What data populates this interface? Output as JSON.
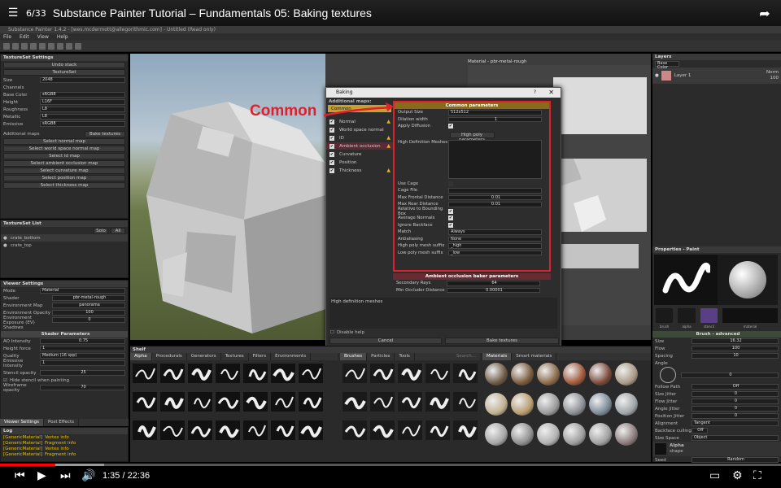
{
  "youtube": {
    "index": "6/33",
    "title": "Substance Painter Tutorial – Fundamentals 05: Baking textures",
    "time": "1:35 / 22:36",
    "progress_fraction": 0.07
  },
  "app": {
    "window_title": "Substance Painter 1.4.2 - [wes.mcdermott@allegorithmic.com] - Untitled (Read only)",
    "menu": [
      "File",
      "Edit",
      "View",
      "Help"
    ]
  },
  "textureset_settings": {
    "title": "TextureSet Settings",
    "undo_stack": "Undo stack",
    "textureset": "TextureSet",
    "size_label": "Size",
    "size_value": "2048",
    "channels_label": "Channels",
    "channels": [
      {
        "name": "Base Color",
        "format": "sRGB8"
      },
      {
        "name": "Height",
        "format": "L16F"
      },
      {
        "name": "Roughness",
        "format": "L8"
      },
      {
        "name": "Metallic",
        "format": "L8"
      },
      {
        "name": "Emissive",
        "format": "sRGB8"
      }
    ],
    "additional_maps": "Additional maps",
    "bake_textures": "Bake textures",
    "map_buttons": [
      "Select normal map",
      "Select world space normal map",
      "Select id map",
      "Select ambient occlusion map",
      "Select curvature map",
      "Select position map",
      "Select thickness map"
    ]
  },
  "textureset_list": {
    "title": "TextureSet List",
    "solo": "Solo",
    "all": "All",
    "items": [
      "crate_bottom",
      "crate_top"
    ]
  },
  "viewer_settings": {
    "title": "Viewer Settings",
    "mode_label": "Mode",
    "mode_value": "Material",
    "shader_label": "Shader",
    "shader_value": "pbr-metal-rough",
    "env_map_label": "Environment Map",
    "env_map_value": "panorama",
    "env_opacity_label": "Environment Opacity",
    "env_opacity_value": "100",
    "env_exposure_label": "Environment Exposure (EV)",
    "env_exposure_value": "0",
    "shadows_label": "Shadows",
    "shader_params": "Shader Parameters",
    "ao_label": "AO Intensity",
    "ao_value": "0.75",
    "height_force_label": "Height force",
    "height_force_value": "1",
    "quality_label": "Quality",
    "quality_value": "Medium (16 spp)",
    "emissive_label": "Emissive Intensity",
    "emissive_value": "1",
    "stencil_label": "Stencil opacity",
    "stencil_value": "25",
    "hide_stencil": "Hide stencil when painting",
    "wireframe_label": "Wireframe opacity",
    "wireframe_value": "70",
    "tabs": [
      "Viewer Settings",
      "Post Effects"
    ]
  },
  "log": {
    "title": "Log",
    "lines": [
      {
        "src": "[GenericMaterial]",
        "msg": "Vertex info"
      },
      {
        "src": "[GenericMaterial]",
        "msg": "Fragment info"
      },
      {
        "src": "[GenericMaterial]",
        "msg": "Vertex info"
      },
      {
        "src": "[GenericMaterial]",
        "msg": "Fragment info"
      }
    ]
  },
  "viewport": {
    "material_label": "Material - pbr-metal-rough"
  },
  "baking": {
    "title": "Baking",
    "help": "?",
    "additional_maps": "Additional maps:",
    "common": "Common",
    "maps": [
      {
        "name": "Normal",
        "warn": true
      },
      {
        "name": "World space normal",
        "warn": false
      },
      {
        "name": "ID",
        "warn": true
      },
      {
        "name": "Ambient occlusion",
        "warn": true
      },
      {
        "name": "Curvature",
        "warn": false
      },
      {
        "name": "Position",
        "warn": false
      },
      {
        "name": "Thickness",
        "warn": true
      }
    ],
    "common_params": "Common parameters",
    "output_size_label": "Output Size",
    "output_size_value": "512x512",
    "dilation_label": "Dilation width",
    "dilation_value": "1",
    "apply_diffusion": "Apply Diffusion",
    "hp_params": "High poly parameters",
    "hd_meshes": "High Definition Meshes",
    "use_cage": "Use Cage",
    "cage_file": "Cage File",
    "max_frontal_label": "Max Frontal Distance",
    "max_frontal_value": "0.01",
    "max_rear_label": "Max Rear Distance",
    "max_rear_value": "0.01",
    "relative_bbox": "Relative to Bounding Box",
    "average_normals": "Average Normals",
    "ignore_backface": "Ignore Backface",
    "match_label": "Match",
    "match_value": "Always",
    "antialias_label": "Antialiasing",
    "antialias_value": "None",
    "hp_suffix_label": "High poly mesh suffix",
    "hp_suffix_value": "_high",
    "lp_suffix_label": "Low poly mesh suffix",
    "lp_suffix_value": "_low",
    "ao_params": "Ambient occlusion baker parameters",
    "secondary_rays_label": "Secondary Rays",
    "secondary_rays_value": "64",
    "min_occ_label": "Min Occluder Distance",
    "min_occ_value": "0.00001",
    "hd_meshes_footer": "High definition meshes",
    "disable_help": "Disable help",
    "cancel": "Cancel",
    "bake": "Bake textures"
  },
  "shelf": {
    "title": "Shelf",
    "tabs": [
      "Alpha",
      "Procedurals",
      "Generators",
      "Textures",
      "Filters",
      "Environments"
    ],
    "alphas": [
      "Alpha Cracks",
      "Alpha Cracks",
      "Alpha Dirt 01",
      "Alpha Dirt 02",
      "Alpha Dirt 03",
      "Alpha Dirt 04",
      "Alpha Dirt 05",
      "Alpha Dirt 06",
      "Alpha_scratch",
      "Alpha Scratch",
      "Gaussian Noise",
      "Shape line",
      "Mold",
      "film",
      "Splash",
      "Stitch",
      "Zipper",
      "Alpha Stripes",
      "cells",
      "Scratches",
      "shape"
    ],
    "brush_tabs": [
      "Brushes",
      "Particles",
      "Tools"
    ],
    "brushes": [
      "artistic 1",
      "artistic 2",
      "artistic 3",
      "artistic 4",
      "artistic 5",
      "artistic 6",
      "cotton",
      "cracks",
      "crystal",
      "default brush",
      "dirt",
      "dirt 2",
      "dirt 3",
      "dust",
      "fibers"
    ],
    "mat_tabs": [
      "Materials",
      "Smart materials"
    ],
    "materials": [
      "Backpack padding",
      "Bark dead pine",
      "Bark old pines",
      "Bricks 001",
      "Bricks 003",
      "Carmen basic",
      "Cap",
      "Cardboard 001",
      "Concrete 002",
      "Concrete 005",
      "Concrete 006",
      "Concrete 010",
      "Concrete 011",
      "Concrete 044",
      "Concrete 070",
      "Concrete 072",
      "Concrete 073",
      "Crab shimmer"
    ],
    "search": "Search..."
  },
  "layers": {
    "title": "Layers",
    "channel": "Base Color",
    "blend": "Norm",
    "opacity": "100",
    "layer_name": "Layer 1"
  },
  "properties": {
    "title": "Properties - Paint",
    "thumbs": [
      "brush",
      "alpha",
      "stencil"
    ],
    "mat_label": "material",
    "section": "Brush - advanced",
    "rows": [
      {
        "label": "Size",
        "value": "16.32"
      },
      {
        "label": "Flow",
        "value": "100"
      },
      {
        "label": "Spacing",
        "value": "10"
      }
    ],
    "angle_label": "Angle",
    "angle_value": "0",
    "follow_path_label": "Follow Path",
    "follow_path_value": "Off",
    "jitter_rows": [
      {
        "label": "Size Jitter",
        "value": "0"
      },
      {
        "label": "Flow Jitter",
        "value": "0"
      },
      {
        "label": "Angle Jitter",
        "value": "0"
      },
      {
        "label": "Position Jitter",
        "value": "0"
      }
    ],
    "alignment_label": "Alignment",
    "alignment_value": "Tangent",
    "backface_label": "Backface culling",
    "backface_value": "Off",
    "size_space_label": "Size Space",
    "size_space_value": "Object",
    "alpha_label": "Alpha",
    "alpha_value": "shape",
    "seed_label": "Seed",
    "seed_value": "Random"
  }
}
